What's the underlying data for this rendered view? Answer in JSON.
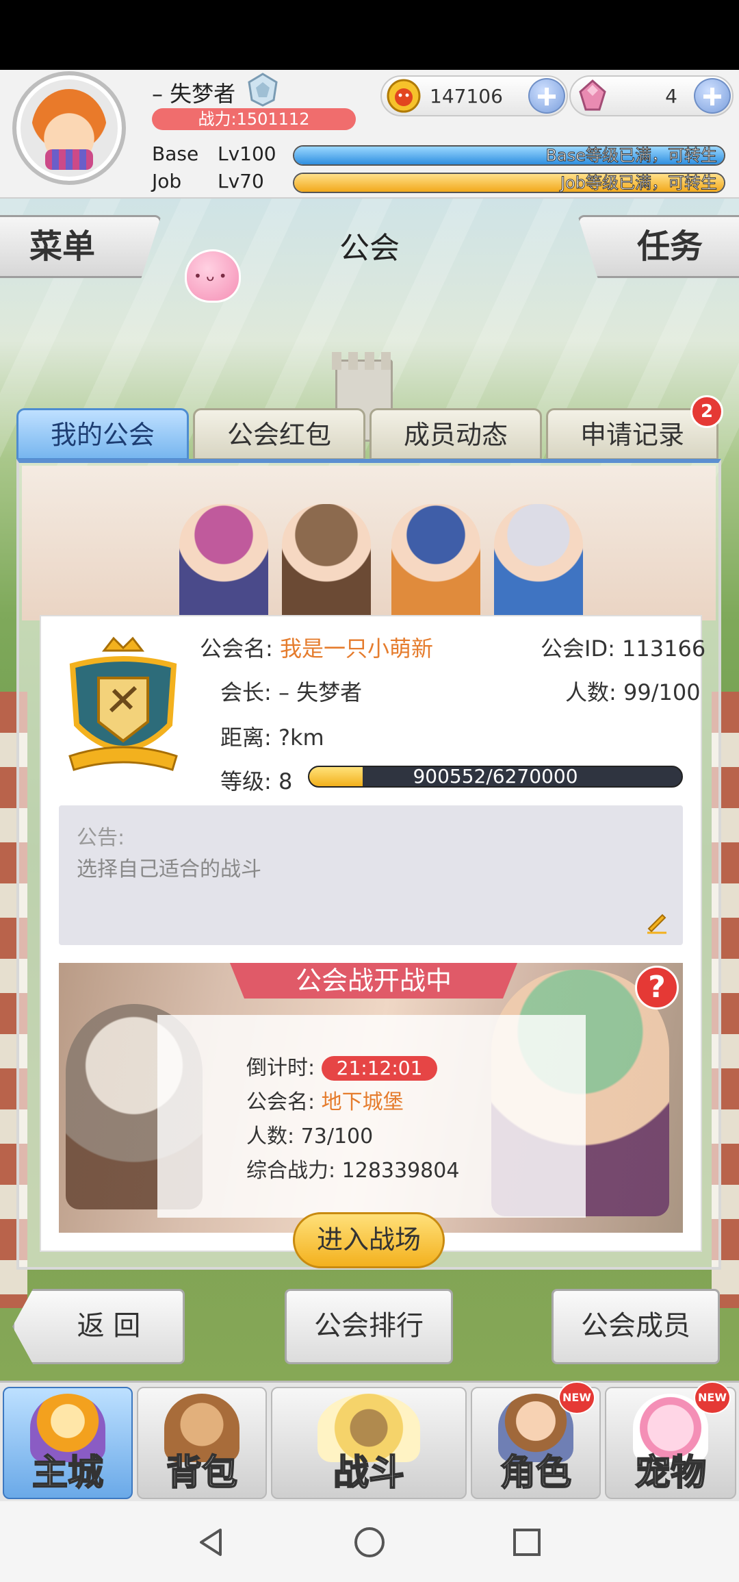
{
  "player": {
    "name": "– 失梦者",
    "power_label": "战力:1501112",
    "gold": "147106",
    "gems": "4",
    "base_label": "Base",
    "base_level": "Lv100",
    "base_status": "Base等级已满，可转生",
    "job_label": "Job",
    "job_level": "Lv70",
    "job_status": "Job等级已满，可转生"
  },
  "header": {
    "menu": "菜单",
    "title": "公会",
    "task": "任务"
  },
  "tabs": [
    {
      "label": "我的公会"
    },
    {
      "label": "公会红包"
    },
    {
      "label": "成员动态"
    },
    {
      "label": "申请记录",
      "badge": "2"
    }
  ],
  "guild": {
    "name_label": "公会名:",
    "name": "我是一只小萌新",
    "id_label": "公会ID:",
    "id": "113166",
    "leader_label": "会长:",
    "leader": "– 失梦者",
    "members_label": "人数:",
    "members": "99/100",
    "distance_label": "距离:",
    "distance": "?km",
    "level_label": "等级:",
    "level": "8",
    "exp_text": "900552/6270000",
    "exp_progress": 0.1436
  },
  "notice": {
    "label": "公告:",
    "text": "选择自己适合的战斗"
  },
  "war": {
    "title": "公会战开战中",
    "help": "?",
    "countdown_label": "倒计时:",
    "countdown": "21:12:01",
    "guild_label": "公会名:",
    "guild_name": "地下城堡",
    "members_label": "人数:",
    "members": "73/100",
    "power_label": "综合战力:",
    "power": "128339804",
    "enter_button": "进入战场"
  },
  "actions": {
    "back": "返 回",
    "ranking": "公会排行",
    "members": "公会成员"
  },
  "bottom_nav": [
    {
      "label": "主城",
      "active": true
    },
    {
      "label": "背包"
    },
    {
      "label": "战斗"
    },
    {
      "label": "角色",
      "badge": "NEW"
    },
    {
      "label": "宠物",
      "badge": "NEW"
    }
  ],
  "colors": {
    "accent_blue": "#5b8fd1",
    "highlight_orange": "#e57c2d",
    "alert_red": "#e53935",
    "gold_yellow": "#f3b11e"
  }
}
